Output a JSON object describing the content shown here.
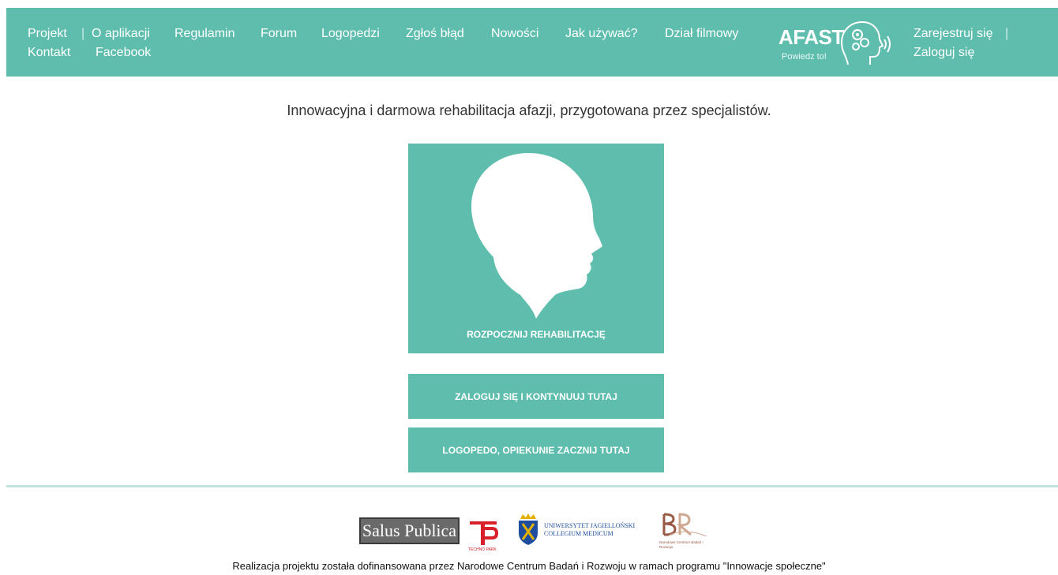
{
  "nav": {
    "projekt": "Projekt",
    "o_aplikacji": "O aplikacji",
    "regulamin": "Regulamin",
    "forum": "Forum",
    "logopedzi": "Logopedzi",
    "zglos_blad": "Zgłoś błąd",
    "nowosci": "Nowości",
    "jak_uzywac": "Jak używać?",
    "dzial_filmowy": "Dział filmowy",
    "kontakt": "Kontakt",
    "facebook": "Facebook",
    "separator": "|"
  },
  "brand": {
    "name": "AFAST",
    "slogan": "Powiedz to!"
  },
  "auth": {
    "register": "Zarejestruj się",
    "login": "Zaloguj się"
  },
  "tagline": "Innowacyjna i darmowa rehabilitacja afazji, przygotowana przez specjalistów.",
  "main": {
    "start_label": "ROZPOCZNIJ REHABILITACJĘ",
    "login_continue_label": "ZALOGUJ SIĘ I KONTYNUUJ TUTAJ",
    "therapist_label": "LOGOPEDO, OPIEKUNIE ZACZNIJ TUTAJ"
  },
  "sponsors": {
    "salus_publica": "Salus Publica",
    "techno_park": "TECHNO PARK",
    "uj_line1": "UNIWERSYTET JAGIELLOŃSKI",
    "uj_line2": "COLLEGIUM MEDICUM",
    "ncbr": "Narodowe Centrum Badań i Rozwoju"
  },
  "footer": {
    "funding_text": "Realizacja projektu została dofinansowana przez Narodowe Centrum Badań i Rozwoju w ramach programu \"Innowacje społeczne\""
  },
  "colors": {
    "accent": "#5ebdad",
    "text": "#333333"
  }
}
